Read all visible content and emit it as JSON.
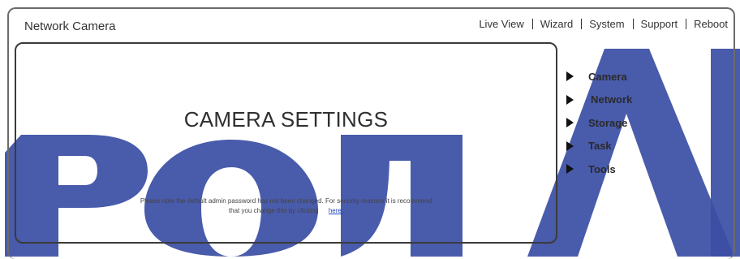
{
  "app": {
    "title": "Network Camera"
  },
  "topnav": {
    "items": [
      {
        "label": "Live View"
      },
      {
        "label": "Wizard"
      },
      {
        "label": "System"
      },
      {
        "label": "Support"
      },
      {
        "label": "Reboot"
      }
    ]
  },
  "panel": {
    "title": "CAMERA SETTINGS",
    "notice_line1": "Please note the default admin password has not been changed. For security reasons it is recommend",
    "notice_line2": "that you change this by clicking",
    "notice_link": "here."
  },
  "sidemenu": {
    "items": [
      {
        "label": "Camera",
        "icon": "play-arrow-icon"
      },
      {
        "label": "Network",
        "icon": "play-arrow-icon"
      },
      {
        "label": "Storage",
        "icon": "play-arrow-icon"
      },
      {
        "label": "Task",
        "icon": "play-arrow-icon"
      },
      {
        "label": "Tools",
        "icon": "play-arrow-icon"
      }
    ]
  },
  "watermark": {
    "text": "РОЛАЙ",
    "color": "#3b4fa5"
  }
}
